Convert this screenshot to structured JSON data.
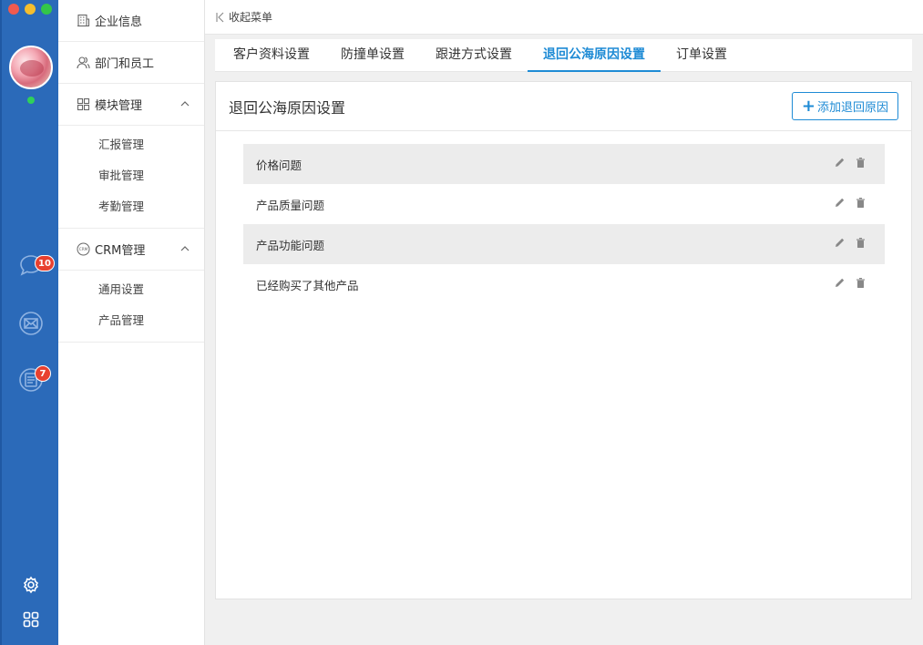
{
  "rail": {
    "badges": {
      "chat": "10",
      "notes": "7"
    },
    "icons": [
      "chat-bubble-icon",
      "mail-icon",
      "notes-icon",
      "settings-icon",
      "apps-grid-icon"
    ]
  },
  "sidebar": {
    "items": [
      {
        "label": "企业信息",
        "icon": "building-icon"
      },
      {
        "label": "部门和员工",
        "icon": "users-icon"
      },
      {
        "label": "模块管理",
        "icon": "modules-grid-icon",
        "sub": [
          "汇报管理",
          "审批管理",
          "考勤管理"
        ]
      },
      {
        "label": "CRM管理",
        "icon": "crm-icon",
        "sub": [
          "通用设置",
          "产品管理"
        ]
      }
    ]
  },
  "topbar": {
    "collapse_label": "收起菜单"
  },
  "tabs": [
    {
      "label": "客户资料设置"
    },
    {
      "label": "防撞单设置"
    },
    {
      "label": "跟进方式设置"
    },
    {
      "label": "退回公海原因设置",
      "active": true
    },
    {
      "label": "订单设置"
    }
  ],
  "panel": {
    "title": "退回公海原因设置",
    "add_button": "添加退回原因",
    "reasons": [
      "价格问题",
      "产品质量问题",
      "产品功能问题",
      "已经购买了其他产品"
    ]
  },
  "colors": {
    "rail": "#2b6ab9",
    "accent": "#1e8bd5",
    "badge": "#e8402f"
  }
}
